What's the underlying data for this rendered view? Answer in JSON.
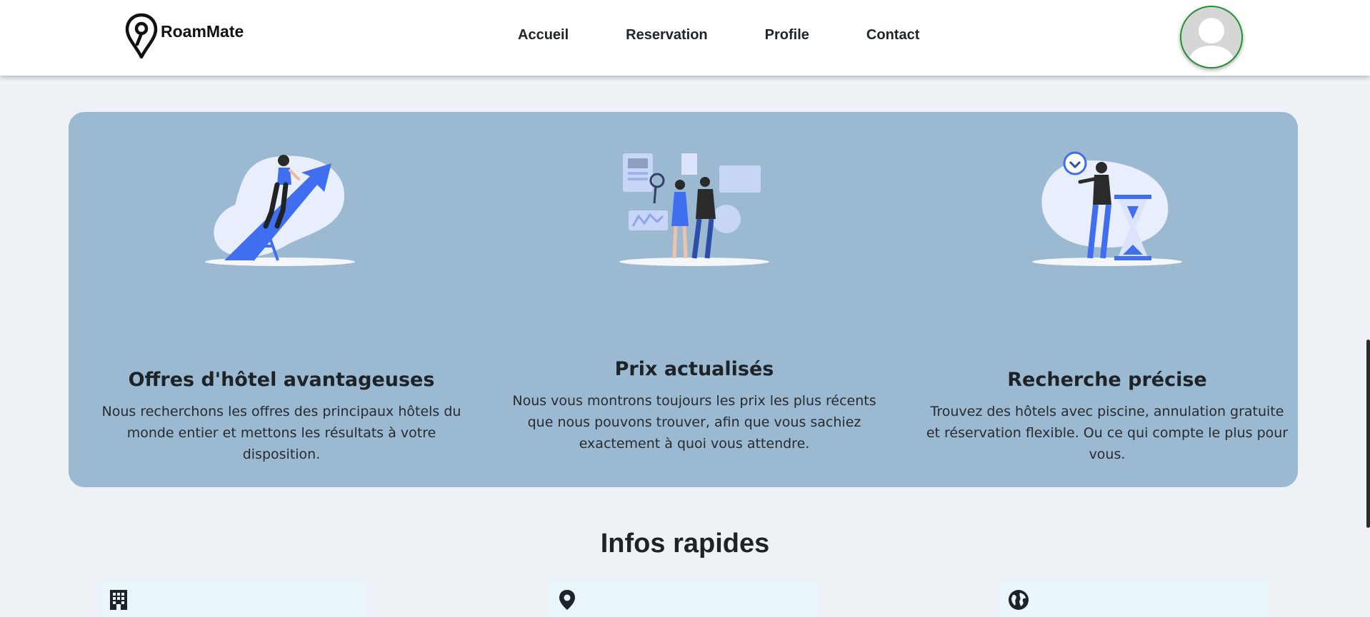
{
  "brand": {
    "name": "RoamMate",
    "logo_icon": "map-pin-icon"
  },
  "nav": {
    "links": [
      "Accueil",
      "Reservation",
      "Profile",
      "Contact"
    ]
  },
  "profile": {
    "avatar_icon": "user-avatar-icon",
    "border_color": "#1f8f2f"
  },
  "features": [
    {
      "illustration": "growth-arrow-illustration",
      "title": "Offres d'hôtel avantageuses",
      "description": "Nous recherchons les offres des principaux hôtels du monde entier et mettons les résultats à votre disposition."
    },
    {
      "illustration": "analytics-team-illustration",
      "title": "Prix actualisés",
      "description": "Nous vous montrons toujours les prix les plus récents que nous pouvons trouver, afin que vous sachiez exactement à quoi vous attendre."
    },
    {
      "illustration": "hourglass-waiting-illustration",
      "title": "Recherche précise",
      "description": "Trouvez des hôtels avec piscine, annulation gratuite et réservation flexible. Ou ce qui compte le plus pour vous."
    }
  ],
  "infos": {
    "title": "Infos rapides",
    "cards": [
      {
        "icon": "building-icon"
      },
      {
        "icon": "location-pin-icon"
      },
      {
        "icon": "globe-icon"
      }
    ]
  },
  "colors": {
    "page_bg": "#eef2f7",
    "card_bg": "#9bbad1",
    "accent": "#3f6ef0",
    "info_card_bg": "#eaf4fb"
  }
}
